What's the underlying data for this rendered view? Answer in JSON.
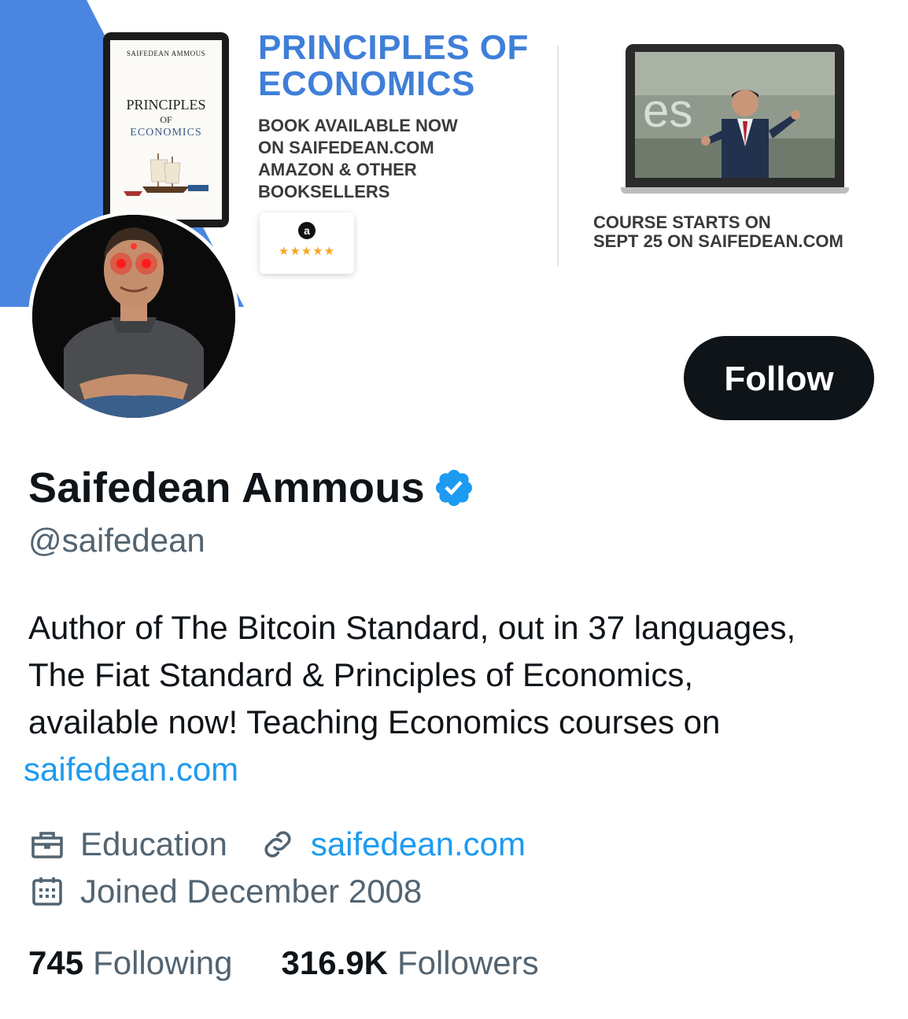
{
  "banner": {
    "tablet": {
      "author": "SAIFEDEAN AMMOUS",
      "title": "PRINCIPLES",
      "of": "OF",
      "subtitle": "ECONOMICS"
    },
    "promo_title_line1": "PRINCIPLES OF",
    "promo_title_line2": "ECONOMICS",
    "promo_line1": "BOOK AVAILABLE NOW",
    "promo_line2": "ON SAIFEDEAN.COM",
    "promo_line3": "AMAZON & OTHER",
    "promo_line4": "BOOKSELLERS",
    "rating_icon": "a",
    "rating_stars": "★★★★★",
    "course_line1": "COURSE STARTS ON",
    "course_line2": "SEPT 25 ON SAIFEDEAN.COM",
    "accent_color": "#4a86e0"
  },
  "profile": {
    "follow_label": "Follow",
    "display_name": "Saifedean Ammous",
    "verified": true,
    "handle": "@saifedean",
    "bio_line1": "Author of The Bitcoin Standard, out in 37 languages,",
    "bio_line2": "The Fiat Standard & Principles of Economics,",
    "bio_line3": "available now! Teaching Economics courses on",
    "bio_link": "saifedean.com",
    "category": "Education",
    "category_icon": "briefcase-icon",
    "website": "saifedean.com",
    "website_icon": "link-icon",
    "joined": "Joined December 2008",
    "joined_icon": "calendar-icon"
  },
  "stats": {
    "following_count": "745",
    "following_label": "Following",
    "followers_count": "316.9K",
    "followers_label": "Followers"
  },
  "colors": {
    "link": "#1d9bf0",
    "secondary_text": "#536471",
    "primary_text": "#0f1419",
    "verified": "#1d9bf0"
  }
}
